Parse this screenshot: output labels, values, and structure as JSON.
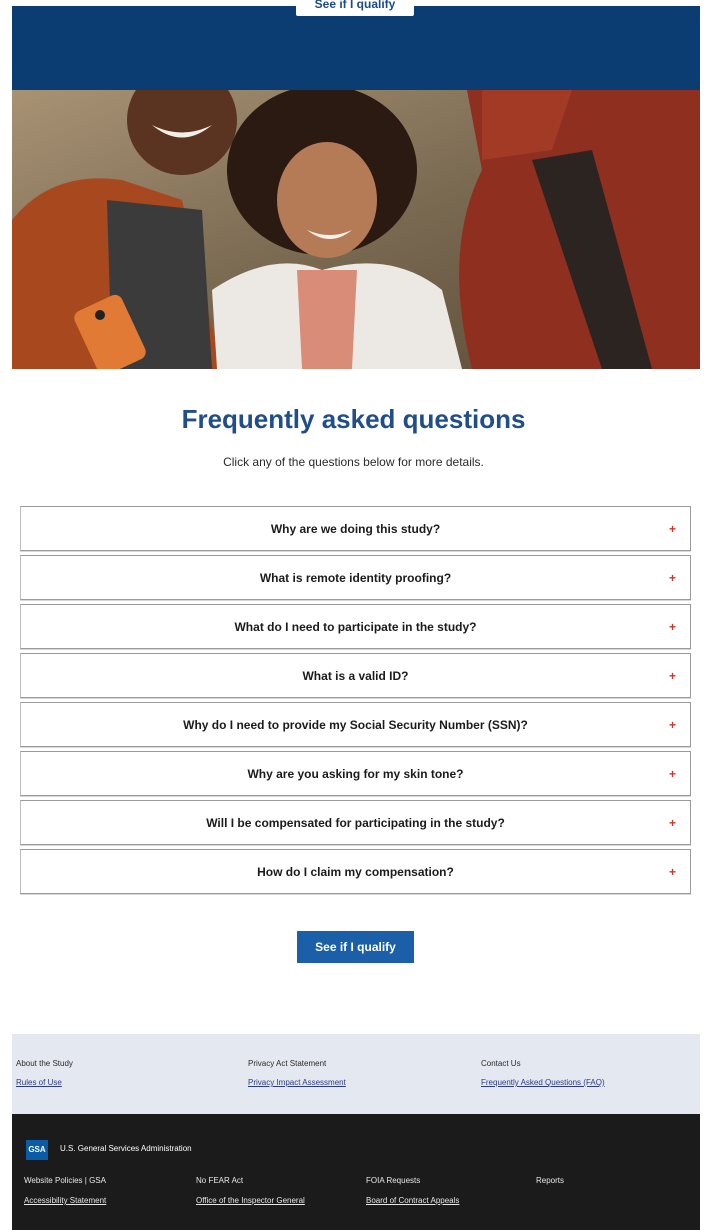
{
  "header": {
    "top_button_label": "See if I qualify"
  },
  "faq": {
    "title": "Frequently asked questions",
    "subtitle": "Click any of the questions below for more details.",
    "plus_icon": "+",
    "questions": [
      "Why are we doing this study?",
      "What is remote identity proofing?",
      "What do I need to participate in the study?",
      "What is a valid ID?",
      "Why do I need to provide my Social Security Number (SSN)?",
      "Why are you asking for my skin tone?",
      "Will I be compensated for participating in the study?",
      "How do I claim my compensation?"
    ],
    "cta_label": "See if I qualify"
  },
  "footer_light": {
    "col1": [
      "About the Study",
      "Rules of Use"
    ],
    "col2": [
      "Privacy Act Statement",
      "Privacy Impact Assessment"
    ],
    "col3": [
      "Contact Us",
      "Frequently Asked Questions (FAQ)"
    ]
  },
  "footer_dark": {
    "logo_text": "GSA",
    "agency": "U.S. General Services Administration",
    "row1": [
      "Website Policies | GSA",
      "No FEAR Act",
      "FOIA Requests",
      "Reports"
    ],
    "row2": [
      "Accessibility Statement",
      "Office of the Inspector General",
      "Board of Contract Appeals"
    ]
  },
  "colors": {
    "brand_blue": "#0b3d72",
    "heading_blue": "#1f4e8a",
    "button_blue": "#1a5fa8",
    "plus_red": "#d0352b"
  }
}
